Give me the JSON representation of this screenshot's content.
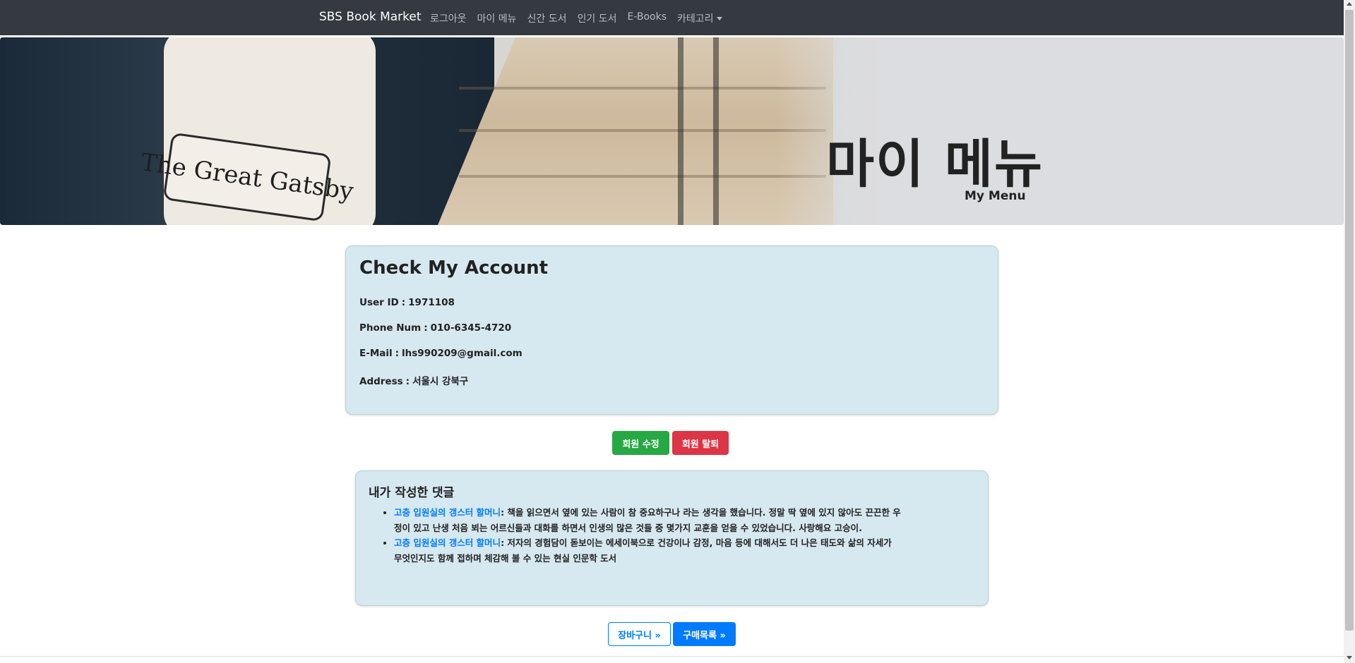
{
  "navbar": {
    "brand": "SBS Book Market",
    "links": [
      "로그아웃",
      "마이 메뉴",
      "신간 도서",
      "인기 도서",
      "E-Books",
      "카테고리"
    ],
    "bg_color": "#343a40"
  },
  "hero": {
    "title": "마이 메뉴",
    "subtitle": "My Menu",
    "image_text": "The Great Gatsby"
  },
  "account": {
    "title": "Check My Account",
    "rows": [
      {
        "label": "User ID",
        "value": "1971108"
      },
      {
        "label": "Phone Num",
        "value": "010-6345-4720"
      },
      {
        "label": "E-Mail",
        "value": "lhs990209@gmail.com"
      },
      {
        "label": "Address",
        "value": "서울시 강북구"
      }
    ],
    "separator": ":"
  },
  "actions": {
    "edit_label": "회원 수정",
    "delete_label": "회원 탈퇴",
    "cart_label": "장바구니 »",
    "orders_label": "구매목록 »"
  },
  "comments": {
    "title": "내가 작성한 댓글",
    "items": [
      {
        "book": "고층 입원실의 갱스터 할머니",
        "text": ": 책을 읽으면서 옆에 있는 사람이 참 중요하구나 라는 생각을 했습니다. 정말 딱 옆에 있지 않아도 끈끈한 우정이 있고 난생 처음 뵈는 어르신들과 대화를 하면서 인생의 많은 것들 중 몇가지 교훈을 얻을 수 있었습니다. 사랑해요 고승이."
      },
      {
        "book": "고층 입원실의 갱스터 할머니",
        "text": ": 저자의 경험담이 돋보이는 에세이북으로 건강이나 감정, 마음 등에 대해서도 더 나은 태도와 삶의 자세가 무엇인지도 함께 접하며 체감해 볼 수 있는 현실 인문학 도서"
      }
    ]
  },
  "colors": {
    "card_bg": "#d6e8f0",
    "success": "#28a745",
    "danger": "#dc3545",
    "primary": "#007bff"
  }
}
